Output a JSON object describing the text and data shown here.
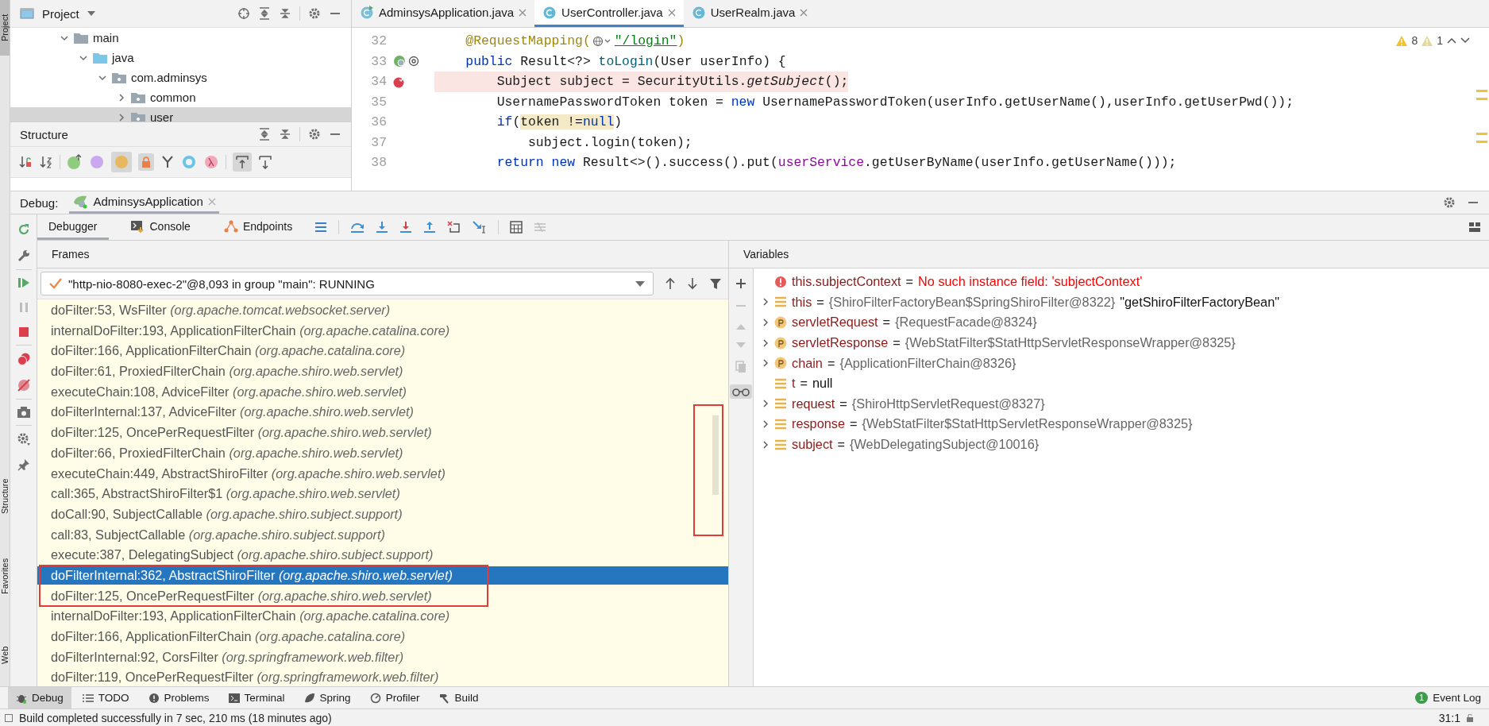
{
  "side_tabs": [
    {
      "label": "Project",
      "selected": true
    },
    {
      "label": "Structure",
      "selected": false
    },
    {
      "label": "Favorites",
      "selected": false
    },
    {
      "label": "Web",
      "selected": false
    }
  ],
  "project": {
    "title": "Project",
    "tree": [
      {
        "label": "main",
        "expanded": true,
        "selected": false,
        "kind": "folder",
        "children": [
          {
            "label": "java",
            "expanded": true,
            "selected": false,
            "kind": "source",
            "children": [
              {
                "label": "com.adminsys",
                "expanded": true,
                "selected": false,
                "kind": "package",
                "children": [
                  {
                    "label": "common",
                    "expanded": false,
                    "selected": false,
                    "kind": "package"
                  },
                  {
                    "label": "user",
                    "expanded": false,
                    "selected": true,
                    "kind": "package"
                  }
                ]
              }
            ]
          }
        ]
      }
    ]
  },
  "structure": {
    "title": "Structure"
  },
  "editor": {
    "tabs": [
      {
        "label": "AdminsysApplication.java",
        "selected": false,
        "kind": "app"
      },
      {
        "label": "UserController.java",
        "selected": true,
        "kind": "class"
      },
      {
        "label": "UserRealm.java",
        "selected": false,
        "kind": "class"
      }
    ],
    "inspections": {
      "warnings": "8",
      "weak_warnings": "1"
    },
    "lines": [
      {
        "number": "32",
        "current": false,
        "bean_marker": false,
        "breakpoint": false,
        "segments": [
          {
            "text": "    @RequestMapping(",
            "kind": "annotation"
          },
          {
            "kind": "inlay"
          },
          {
            "text": "\"/login\"",
            "kind": "string"
          },
          {
            "text": ")",
            "kind": "annotation"
          }
        ]
      },
      {
        "number": "33",
        "current": false,
        "bean_marker": true,
        "breakpoint": false,
        "segments": [
          {
            "text": "    public ",
            "kind": "keyword"
          },
          {
            "text": "Result<?> ",
            "kind": "plain"
          },
          {
            "text": "toLogin",
            "kind": "method"
          },
          {
            "text": "(User userInfo) {",
            "kind": "plain"
          }
        ]
      },
      {
        "number": "34",
        "current": true,
        "bean_marker": false,
        "breakpoint": true,
        "segments": [
          {
            "text": "        Subject subject = SecurityUtils.",
            "kind": "plain"
          },
          {
            "text": "getSubject",
            "kind": "italic"
          },
          {
            "text": "();",
            "kind": "plain"
          }
        ]
      },
      {
        "number": "35",
        "current": false,
        "bean_marker": false,
        "breakpoint": false,
        "segments": [
          {
            "text": "        UsernamePasswordToken token = ",
            "kind": "plain"
          },
          {
            "text": "new ",
            "kind": "keyword"
          },
          {
            "text": "UsernamePasswordToken(userInfo.getUserName(),userInfo.getUserPwd());",
            "kind": "plain"
          }
        ]
      },
      {
        "number": "36",
        "current": false,
        "bean_marker": false,
        "breakpoint": false,
        "segments": [
          {
            "text": "        if",
            "kind": "keyword"
          },
          {
            "text": "(",
            "kind": "plain"
          },
          {
            "text": "token !=",
            "kind": "plain",
            "highlight": true
          },
          {
            "text": "null",
            "kind": "keyword",
            "highlight": true
          },
          {
            "text": ")",
            "kind": "plain"
          }
        ]
      },
      {
        "number": "37",
        "current": false,
        "bean_marker": false,
        "breakpoint": false,
        "segments": [
          {
            "text": "            subject.login(token);",
            "kind": "plain"
          }
        ]
      },
      {
        "number": "38",
        "current": false,
        "bean_marker": false,
        "breakpoint": false,
        "segments": [
          {
            "text": "        return new ",
            "kind": "keyword"
          },
          {
            "text": "Result<>().success().put(",
            "kind": "plain"
          },
          {
            "text": "userService",
            "kind": "field"
          },
          {
            "text": ".getUserByName(userInfo.getUserName()));",
            "kind": "plain"
          }
        ]
      }
    ]
  },
  "debug": {
    "label": "Debug:",
    "session": "AdminsysApplication",
    "tabs": [
      {
        "label": "Debugger",
        "selected": true,
        "kind": "debugger"
      },
      {
        "label": "Console",
        "selected": false,
        "kind": "console"
      },
      {
        "label": "Endpoints",
        "selected": false,
        "kind": "endpoints"
      }
    ]
  },
  "frames": {
    "title": "Frames",
    "thread": "\"http-nio-8080-exec-2\"@8,093 in group \"main\": RUNNING",
    "items": [
      {
        "method": "doFilter:53, WsFilter",
        "package": "(org.apache.tomcat.websocket.server)",
        "selected": false
      },
      {
        "method": "internalDoFilter:193, ApplicationFilterChain",
        "package": "(org.apache.catalina.core)",
        "selected": false
      },
      {
        "method": "doFilter:166, ApplicationFilterChain",
        "package": "(org.apache.catalina.core)",
        "selected": false
      },
      {
        "method": "doFilter:61, ProxiedFilterChain",
        "package": "(org.apache.shiro.web.servlet)",
        "selected": false
      },
      {
        "method": "executeChain:108, AdviceFilter",
        "package": "(org.apache.shiro.web.servlet)",
        "selected": false
      },
      {
        "method": "doFilterInternal:137, AdviceFilter",
        "package": "(org.apache.shiro.web.servlet)",
        "selected": false
      },
      {
        "method": "doFilter:125, OncePerRequestFilter",
        "package": "(org.apache.shiro.web.servlet)",
        "selected": false
      },
      {
        "method": "doFilter:66, ProxiedFilterChain",
        "package": "(org.apache.shiro.web.servlet)",
        "selected": false
      },
      {
        "method": "executeChain:449, AbstractShiroFilter",
        "package": "(org.apache.shiro.web.servlet)",
        "selected": false
      },
      {
        "method": "call:365, AbstractShiroFilter$1",
        "package": "(org.apache.shiro.web.servlet)",
        "selected": false
      },
      {
        "method": "doCall:90, SubjectCallable",
        "package": "(org.apache.shiro.subject.support)",
        "selected": false
      },
      {
        "method": "call:83, SubjectCallable",
        "package": "(org.apache.shiro.subject.support)",
        "selected": false
      },
      {
        "method": "execute:387, DelegatingSubject",
        "package": "(org.apache.shiro.subject.support)",
        "selected": false
      },
      {
        "method": "doFilterInternal:362, AbstractShiroFilter",
        "package": "(org.apache.shiro.web.servlet)",
        "selected": true
      },
      {
        "method": "doFilter:125, OncePerRequestFilter",
        "package": "(org.apache.shiro.web.servlet)",
        "selected": false
      },
      {
        "method": "internalDoFilter:193, ApplicationFilterChain",
        "package": "(org.apache.catalina.core)",
        "selected": false
      },
      {
        "method": "doFilter:166, ApplicationFilterChain",
        "package": "(org.apache.catalina.core)",
        "selected": false
      },
      {
        "method": "doFilterInternal:92, CorsFilter",
        "package": "(org.springframework.web.filter)",
        "selected": false
      },
      {
        "method": "doFilter:119, OncePerRequestFilter",
        "package": "(org.springframework.web.filter)",
        "selected": false
      }
    ]
  },
  "variables": {
    "title": "Variables",
    "items": [
      {
        "kind": "error",
        "name": "this.subjectContext",
        "operator": "=",
        "value": "No such instance field: 'subjectContext'",
        "expandable": false
      },
      {
        "kind": "field",
        "name": "this",
        "operator": "=",
        "value": "{ShiroFilterFactoryBean$SpringShiroFilter@8322}",
        "extra": "\"getShiroFilterFactoryBean\"",
        "expandable": true
      },
      {
        "kind": "param",
        "name": "servletRequest",
        "operator": "=",
        "value": "{RequestFacade@8324}",
        "expandable": true
      },
      {
        "kind": "param",
        "name": "servletResponse",
        "operator": "=",
        "value": "{WebStatFilter$StatHttpServletResponseWrapper@8325}",
        "expandable": true
      },
      {
        "kind": "param",
        "name": "chain",
        "operator": "=",
        "value": "{ApplicationFilterChain@8326}",
        "expandable": true
      },
      {
        "kind": "field",
        "name": "t",
        "operator": "=",
        "value": "null",
        "expandable": false
      },
      {
        "kind": "field",
        "name": "request",
        "operator": "=",
        "value": "{ShiroHttpServletRequest@8327}",
        "expandable": true
      },
      {
        "kind": "field",
        "name": "response",
        "operator": "=",
        "value": "{WebStatFilter$StatHttpServletResponseWrapper@8325}",
        "expandable": true
      },
      {
        "kind": "field",
        "name": "subject",
        "operator": "=",
        "value": "{WebDelegatingSubject@10016}",
        "expandable": true
      }
    ]
  },
  "markup": [
    {
      "kind": "red_box"
    },
    {
      "kind": "red_box"
    }
  ],
  "tool_windows": [
    {
      "label": "Debug",
      "selected": true,
      "kind": "debug"
    },
    {
      "label": "TODO",
      "selected": false,
      "kind": "todo"
    },
    {
      "label": "Problems",
      "selected": false,
      "kind": "problems"
    },
    {
      "label": "Terminal",
      "selected": false,
      "kind": "terminal"
    },
    {
      "label": "Spring",
      "selected": false,
      "kind": "spring"
    },
    {
      "label": "Profiler",
      "selected": false,
      "kind": "profiler"
    },
    {
      "label": "Build",
      "selected": false,
      "kind": "build"
    }
  ],
  "event_log": {
    "label": "Event Log",
    "count": "1"
  },
  "status_bar": {
    "message": "Build completed successfully in 7 sec, 210 ms (18 minutes ago)",
    "position": "31:1"
  }
}
